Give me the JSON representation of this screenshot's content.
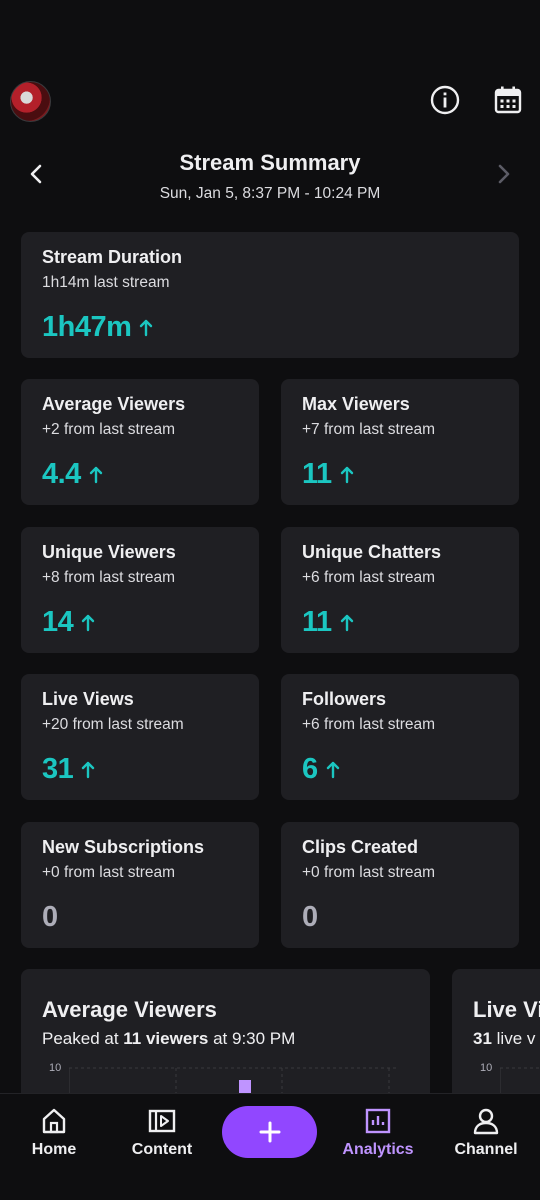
{
  "header": {
    "title": "Stream Summary",
    "date_range": "Sun, Jan 5, 8:37 PM - 10:24 PM"
  },
  "icons": {
    "info": "info-icon",
    "calendar": "calendar-icon",
    "back": "chevron-left-icon",
    "next": "chevron-right-icon",
    "trend_up": "arrow-up-icon"
  },
  "colors": {
    "accent_up": "#1bc6c1",
    "brand": "#9147ff",
    "active_nav": "#bf94ff",
    "card_bg": "#1f1f23",
    "neutral_value": "#adadb8"
  },
  "stats": {
    "stream_duration": {
      "title": "Stream Duration",
      "sub": "1h14m last stream",
      "value": "1h47m",
      "trend": "up"
    },
    "average_viewers": {
      "title": "Average Viewers",
      "sub": "+2 from last stream",
      "value": "4.4",
      "trend": "up"
    },
    "max_viewers": {
      "title": "Max Viewers",
      "sub": "+7 from last stream",
      "value": "11",
      "trend": "up"
    },
    "unique_viewers": {
      "title": "Unique Viewers",
      "sub": "+8 from last stream",
      "value": "14",
      "trend": "up"
    },
    "unique_chatters": {
      "title": "Unique Chatters",
      "sub": "+6 from last stream",
      "value": "11",
      "trend": "up"
    },
    "live_views": {
      "title": "Live Views",
      "sub": "+20 from last stream",
      "value": "31",
      "trend": "up"
    },
    "followers": {
      "title": "Followers",
      "sub": "+6 from last stream",
      "value": "6",
      "trend": "up"
    },
    "new_subscriptions": {
      "title": "New Subscriptions",
      "sub": "+0 from last stream",
      "value": "0",
      "trend": "none"
    },
    "clips_created": {
      "title": "Clips Created",
      "sub": "+0 from last stream",
      "value": "0",
      "trend": "none"
    }
  },
  "graphs": {
    "average_viewers": {
      "title": "Average Viewers",
      "sub_prefix": "Peaked at ",
      "sub_bold": "11 viewers",
      "sub_suffix": " at 9:30 PM",
      "y_tick": "10"
    },
    "live_views": {
      "title": "Live Vi",
      "sub_bold": "31",
      "sub_suffix": " live v",
      "y_tick": "10"
    }
  },
  "bottom_nav": {
    "home": "Home",
    "content": "Content",
    "create": "+",
    "analytics": "Analytics",
    "channel": "Channel"
  }
}
